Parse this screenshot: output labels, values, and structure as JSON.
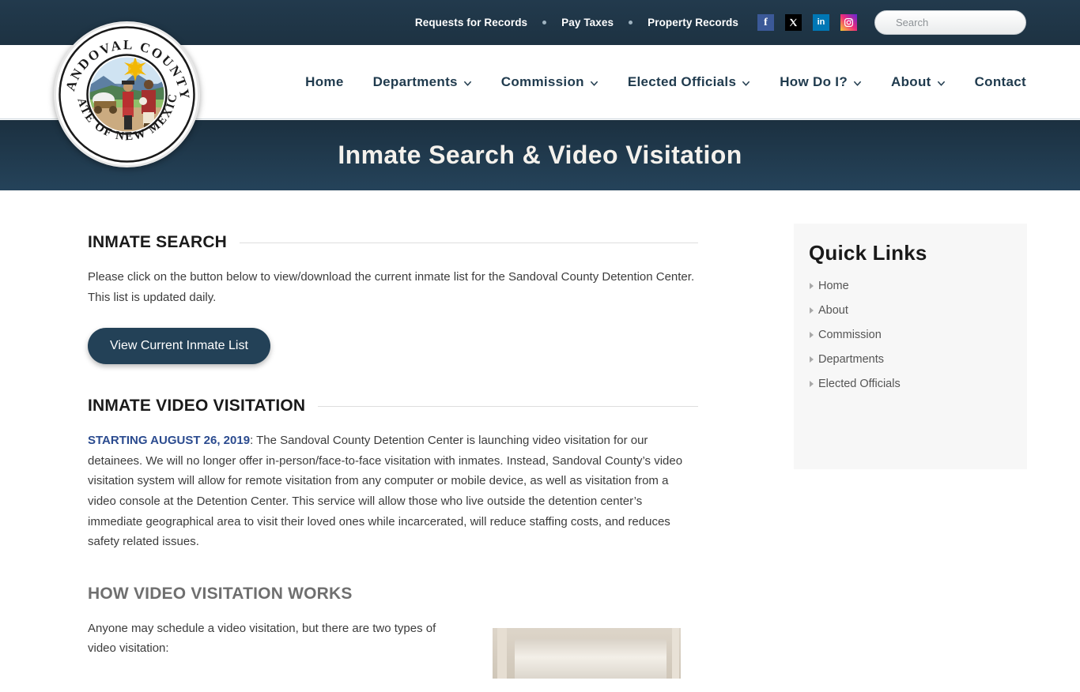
{
  "topbar": {
    "links": [
      {
        "label": "Requests for Records"
      },
      {
        "label": "Pay Taxes"
      },
      {
        "label": "Property Records"
      }
    ],
    "social": [
      {
        "name": "facebook-icon",
        "glyph": "f",
        "color": "#3b5998"
      },
      {
        "name": "x-twitter-icon",
        "glyph": "✕",
        "color": "#000000"
      },
      {
        "name": "linkedin-icon",
        "glyph": "in",
        "color": "#0077b5"
      },
      {
        "name": "instagram-icon",
        "glyph": "▣",
        "color": "#ee2a7b"
      }
    ],
    "search": {
      "placeholder": "Search",
      "value": ""
    }
  },
  "logo": {
    "top_text": "SANDOVAL COUNTY",
    "bottom_text": "STATE OF NEW MEXICO"
  },
  "nav": {
    "items": [
      {
        "label": "Home",
        "has_dropdown": false
      },
      {
        "label": "Departments",
        "has_dropdown": true
      },
      {
        "label": "Commission",
        "has_dropdown": true
      },
      {
        "label": "Elected Officials",
        "has_dropdown": true
      },
      {
        "label": "How Do I?",
        "has_dropdown": true
      },
      {
        "label": "About",
        "has_dropdown": true
      },
      {
        "label": "Contact",
        "has_dropdown": false
      }
    ]
  },
  "banner": {
    "title": "Inmate Search & Video Visitation"
  },
  "main": {
    "inmate_search": {
      "heading": "INMATE SEARCH",
      "paragraph": "Please click on the button below to view/download the current inmate list for the Sandoval County Detention Center. This list is updated daily.",
      "button_label": "View Current Inmate List"
    },
    "video_visitation": {
      "heading": "INMATE VIDEO VISITATION",
      "highlight": "STARTING AUGUST 26, 2019",
      "paragraph": ": The Sandoval County Detention Center is launching video visitation for our detainees. We will no longer offer in-person/face-to-face visitation with inmates. Instead, Sandoval County’s video visitation system will allow for remote visitation from any computer or mobile device, as well as visitation from a video console at the Detention Center. This service will allow those who live outside the detention center’s immediate geographical area to visit their loved ones while incarcerated, will reduce staffing costs, and reduces safety related issues."
    },
    "how_it_works": {
      "heading": "HOW VIDEO VISITATION WORKS",
      "paragraph": "Anyone may schedule a video visitation, but there are two types of video visitation:"
    }
  },
  "sidebar": {
    "title": "Quick Links",
    "items": [
      {
        "label": "Home"
      },
      {
        "label": "About"
      },
      {
        "label": "Commission"
      },
      {
        "label": "Departments"
      },
      {
        "label": "Elected Officials"
      }
    ]
  },
  "colors": {
    "header_dark": "#1d3242",
    "banner_dark": "#25435a",
    "nav_text": "#1f3a4d",
    "accent_blue": "#2b4b8f",
    "button_bg": "#234157",
    "sidebar_bg": "#f7f7f7"
  }
}
